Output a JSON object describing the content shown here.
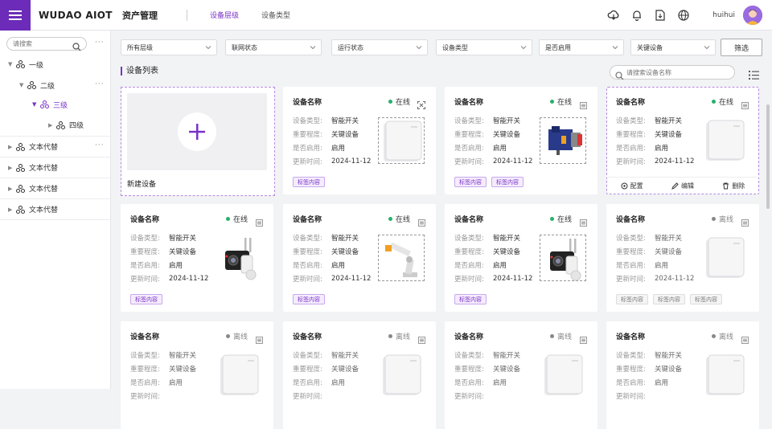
{
  "header": {
    "logo": "WUDAO AIOT",
    "module": "资产管理",
    "tabs": [
      {
        "label": "设备层级",
        "active": true
      },
      {
        "label": "设备类型",
        "active": false
      }
    ],
    "username": "huihui",
    "accent": "#6c2bb8"
  },
  "sidebar": {
    "search_placeholder": "请搜索",
    "tree": [
      {
        "label": "一级"
      },
      {
        "label": "二级"
      },
      {
        "label": "三级"
      },
      {
        "label": "四级"
      },
      {
        "label": "文本代替"
      },
      {
        "label": "文本代替"
      },
      {
        "label": "文本代替"
      },
      {
        "label": "文本代替"
      }
    ]
  },
  "filters": {
    "items": [
      "所有层级",
      "联网状态",
      "运行状态",
      "设备类型",
      "是否启用",
      "关键设备"
    ],
    "button": "筛选"
  },
  "list": {
    "title": "设备列表",
    "search_placeholder": "请搜索设备名称",
    "new_label": "新建设备"
  },
  "field_labels": {
    "type": "设备类型:",
    "importance": "重要程度:",
    "enabled": "是否启用:",
    "updated": "更新时间:"
  },
  "actions": {
    "config": "配置",
    "edit": "编辑",
    "delete": "删除"
  },
  "cards": [
    {
      "title": "设备名称",
      "status": "在线",
      "type": "智能开关",
      "importance": "关键设备",
      "enabled": "启用",
      "updated": "2024-11-12",
      "tags": [
        "标签内容"
      ],
      "thumb": "router-icon"
    },
    {
      "title": "设备名称",
      "status": "在线",
      "type": "智能开关",
      "importance": "关键设备",
      "enabled": "启用",
      "updated": "2024-11-12",
      "tags": [
        "标签内容",
        "标签内容"
      ],
      "thumb": "motor-icon"
    },
    {
      "title": "设备名称",
      "status": "在线",
      "type": "智能开关",
      "importance": "关键设备",
      "enabled": "启用",
      "updated": "2024-11-12",
      "tags": [],
      "thumb": "router-icon"
    },
    {
      "title": "设备名称",
      "status": "在线",
      "type": "智能开关",
      "importance": "关键设备",
      "enabled": "启用",
      "updated": "2024-11-12",
      "tags": [
        "标签内容"
      ],
      "thumb": "camera-icon"
    },
    {
      "title": "设备名称",
      "status": "在线",
      "type": "智能开关",
      "importance": "关键设备",
      "enabled": "启用",
      "updated": "2024-11-12",
      "tags": [
        "标签内容"
      ],
      "thumb": "robot-arm-icon"
    },
    {
      "title": "设备名称",
      "status": "在线",
      "type": "智能开关",
      "importance": "关键设备",
      "enabled": "启用",
      "updated": "2024-11-12",
      "tags": [
        "标签内容"
      ],
      "thumb": "camera-icon"
    },
    {
      "title": "设备名称",
      "status": "离线",
      "type": "智能开关",
      "importance": "关键设备",
      "enabled": "启用",
      "updated": "2024-11-12",
      "tags": [
        "标签内容",
        "标签内容",
        "标签内容"
      ],
      "thumb": "router-icon"
    },
    {
      "title": "设备名称",
      "status": "离线",
      "type": "智能开关",
      "importance": "关键设备",
      "enabled": "启用",
      "updated": "",
      "tags": [],
      "thumb": "router-icon"
    },
    {
      "title": "设备名称",
      "status": "离线",
      "type": "智能开关",
      "importance": "关键设备",
      "enabled": "启用",
      "updated": "",
      "tags": [],
      "thumb": "router-icon"
    },
    {
      "title": "设备名称",
      "status": "离线",
      "type": "智能开关",
      "importance": "关键设备",
      "enabled": "启用",
      "updated": "",
      "tags": [],
      "thumb": "router-icon"
    },
    {
      "title": "设备名称",
      "status": "离线",
      "type": "智能开关",
      "importance": "关键设备",
      "enabled": "启用",
      "updated": "",
      "tags": [],
      "thumb": "router-icon"
    }
  ]
}
